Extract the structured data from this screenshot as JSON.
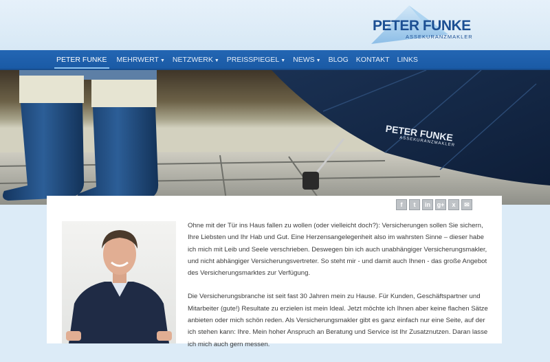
{
  "logo": {
    "name": "PETER FUNKE",
    "subtitle": "ASSEKURANZMAKLER"
  },
  "nav": {
    "items": [
      {
        "label": "PETER FUNKE",
        "dropdown": false,
        "active": true
      },
      {
        "label": "MEHRWERT",
        "dropdown": true,
        "active": false
      },
      {
        "label": "NETZWERK",
        "dropdown": true,
        "active": false
      },
      {
        "label": "PREISSPIEGEL",
        "dropdown": true,
        "active": false
      },
      {
        "label": "NEWS",
        "dropdown": true,
        "active": false
      },
      {
        "label": "BLOG",
        "dropdown": false,
        "active": false
      },
      {
        "label": "KONTAKT",
        "dropdown": false,
        "active": false
      },
      {
        "label": "LINKS",
        "dropdown": false,
        "active": false
      }
    ]
  },
  "hero": {
    "umbrella_brand": "PETER FUNKE",
    "umbrella_sub": "ASSEKURANZMAKLER"
  },
  "share": {
    "icons": [
      {
        "name": "facebook-icon",
        "glyph": "f"
      },
      {
        "name": "twitter-icon",
        "glyph": "t"
      },
      {
        "name": "linkedin-icon",
        "glyph": "in"
      },
      {
        "name": "google-plus-icon",
        "glyph": "g+"
      },
      {
        "name": "xing-icon",
        "glyph": "x"
      },
      {
        "name": "email-icon",
        "glyph": "✉"
      }
    ]
  },
  "content": {
    "paragraph_1": "Ohne mit der Tür ins Haus fallen zu wollen (oder vielleicht doch?): Versicherungen sollen Sie sichern, Ihre Liebsten und Ihr Hab und Gut. Eine Herzensangelegenheit also im wahrsten Sinne – dieser habe ich mich mit Leib und Seele verschrieben. Deswegen bin ich auch unabhängiger Versicherungsmakler, und nicht abhängiger Versicherungsvertreter. So steht mir - und damit auch Ihnen - das große Angebot des Versicherungsmarktes zur Verfügung.",
    "paragraph_2": "Die Versicherungsbranche ist seit fast 30 Jahren mein zu Hause. Für Kunden, Geschäftspartner und Mitarbeiter (gute!) Resultate zu erzielen ist mein Ideal. Jetzt möchte ich Ihnen aber keine flachen Sätze anbieten oder mich schön reden. Als Versicherungsmakler gibt es ganz einfach nur eine Seite, auf der ich stehen kann: Ihre. Mein hoher Anspruch an Beratung und Service ist Ihr Zusatznutzen. Daran lasse ich mich auch gern messen."
  },
  "colors": {
    "nav_bg": "#1f60ac",
    "brand_blue": "#1c4f93",
    "page_bg": "#dcebf7"
  }
}
